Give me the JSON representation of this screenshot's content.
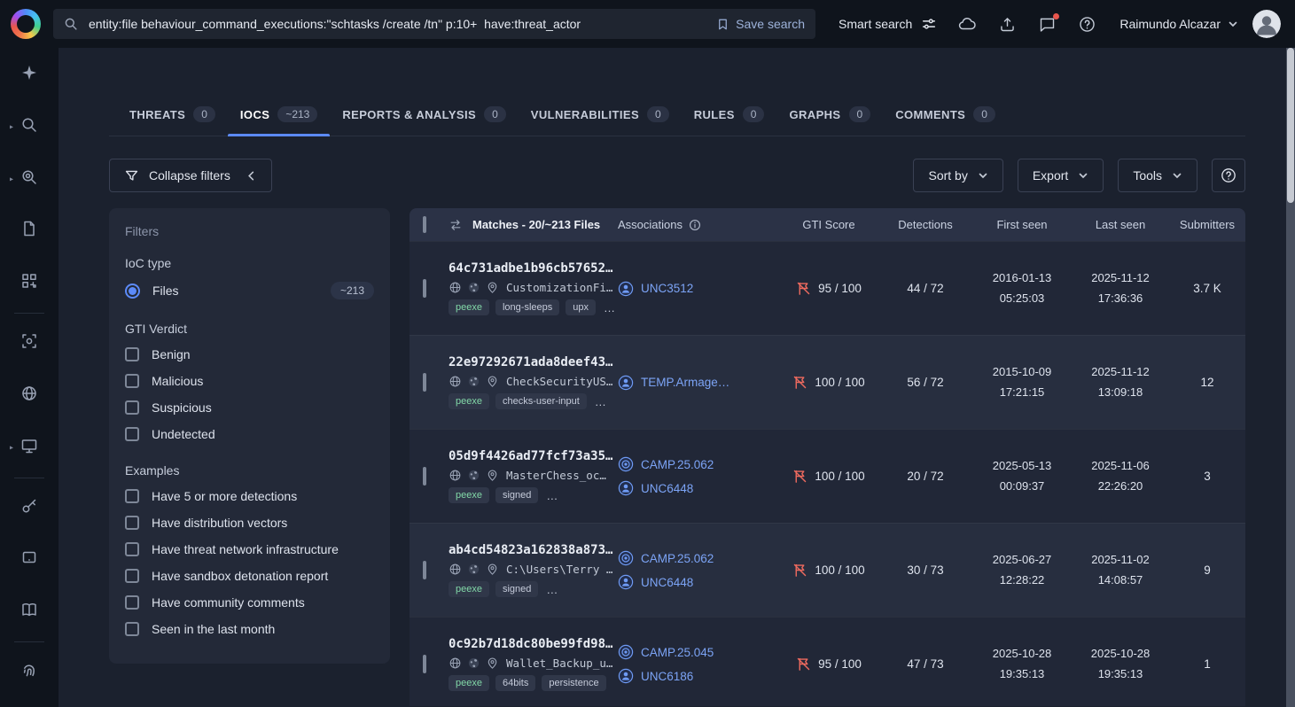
{
  "topbar": {
    "search": {
      "query": "entity:file behaviour_command_executions:\"schtasks /create /tn\" p:10+  have:threat_actor",
      "save_label": "Save search"
    },
    "smart_search_label": "Smart search",
    "icons": [
      "cloud-icon",
      "upload-icon",
      "chat-icon",
      "help-icon"
    ],
    "user_name": "Raimundo Alcazar"
  },
  "sidebar": {
    "items": [
      "ai-sparkles",
      "search",
      "hunting",
      "file",
      "code-similarity",
      "scan",
      "globe",
      "monitor",
      "key",
      "device",
      "references-book",
      "fingerprint"
    ],
    "expandable": [
      1,
      2,
      7
    ],
    "separators_after": [
      4,
      7,
      10
    ]
  },
  "tabs": [
    {
      "label": "THREATS",
      "count": "0"
    },
    {
      "label": "IOCS",
      "count": "~213",
      "active": true
    },
    {
      "label": "REPORTS & ANALYSIS",
      "count": "0"
    },
    {
      "label": "VULNERABILITIES",
      "count": "0"
    },
    {
      "label": "RULES",
      "count": "0"
    },
    {
      "label": "GRAPHS",
      "count": "0"
    },
    {
      "label": "COMMENTS",
      "count": "0"
    }
  ],
  "toolbar": {
    "collapse_filters_label": "Collapse filters",
    "sort_by_label": "Sort by",
    "export_label": "Export",
    "tools_label": "Tools"
  },
  "filters": {
    "title": "Filters",
    "ioc_type_label": "IoC type",
    "ioc_types": [
      {
        "label": "Files",
        "count": "~213",
        "selected": true
      }
    ],
    "verdict_label": "GTI Verdict",
    "verdicts": [
      "Benign",
      "Malicious",
      "Suspicious",
      "Undetected"
    ],
    "examples_label": "Examples",
    "examples": [
      "Have 5 or more detections",
      "Have distribution vectors",
      "Have threat network infrastructure",
      "Have sandbox detonation report",
      "Have community comments",
      "Seen in the last month"
    ]
  },
  "table": {
    "header": {
      "matches": "Matches - 20/~213 Files",
      "associations": "Associations",
      "gti_score": "GTI Score",
      "detections": "Detections",
      "first_seen": "First seen",
      "last_seen": "Last seen",
      "submitters": "Submitters"
    },
    "rows": [
      {
        "hash": "64c731adbe1b96cb57652…",
        "filename": "CustomizationFi…",
        "tags": [
          "peexe",
          "long-sleeps",
          "upx",
          "…"
        ],
        "associations": [
          {
            "label": "UNC3512",
            "type": "actor"
          }
        ],
        "gti_score": "95 / 100",
        "detections": "44 / 72",
        "first_seen_date": "2016-01-13",
        "first_seen_time": "05:25:03",
        "last_seen_date": "2025-11-12",
        "last_seen_time": "17:36:36",
        "submitters": "3.7 K"
      },
      {
        "hash": "22e97292671ada8deef43…",
        "filename": "CheckSecurityUS…",
        "tags": [
          "peexe",
          "checks-user-input",
          "…"
        ],
        "associations": [
          {
            "label": "TEMP.Armage…",
            "type": "actor"
          }
        ],
        "gti_score": "100 / 100",
        "detections": "56 / 72",
        "first_seen_date": "2015-10-09",
        "first_seen_time": "17:21:15",
        "last_seen_date": "2025-11-12",
        "last_seen_time": "13:09:18",
        "submitters": "12"
      },
      {
        "hash": "05d9f4426ad77fcf73a35…",
        "filename": "MasterChess_oc…",
        "tags": [
          "peexe",
          "signed",
          "…"
        ],
        "associations": [
          {
            "label": "CAMP.25.062",
            "type": "campaign"
          },
          {
            "label": "UNC6448",
            "type": "actor"
          }
        ],
        "gti_score": "100 / 100",
        "detections": "20 / 72",
        "first_seen_date": "2025-05-13",
        "first_seen_time": "00:09:37",
        "last_seen_date": "2025-11-06",
        "last_seen_time": "22:26:20",
        "submitters": "3"
      },
      {
        "hash": "ab4cd54823a162838a873…",
        "filename": "C:\\Users\\Terry …",
        "tags": [
          "peexe",
          "signed",
          "…"
        ],
        "associations": [
          {
            "label": "CAMP.25.062",
            "type": "campaign"
          },
          {
            "label": "UNC6448",
            "type": "actor"
          }
        ],
        "gti_score": "100 / 100",
        "detections": "30 / 73",
        "first_seen_date": "2025-06-27",
        "first_seen_time": "12:28:22",
        "last_seen_date": "2025-11-02",
        "last_seen_time": "14:08:57",
        "submitters": "9"
      },
      {
        "hash": "0c92b7d18dc80be99fd98…",
        "filename": "Wallet_Backup_u…",
        "tags": [
          "peexe",
          "64bits",
          "persistence"
        ],
        "associations": [
          {
            "label": "CAMP.25.045",
            "type": "campaign"
          },
          {
            "label": "UNC6186",
            "type": "actor"
          }
        ],
        "gti_score": "95 / 100",
        "detections": "47 / 73",
        "first_seen_date": "2025-10-28",
        "first_seen_time": "19:35:13",
        "last_seen_date": "2025-10-28",
        "last_seen_time": "19:35:13",
        "submitters": "1"
      }
    ]
  }
}
